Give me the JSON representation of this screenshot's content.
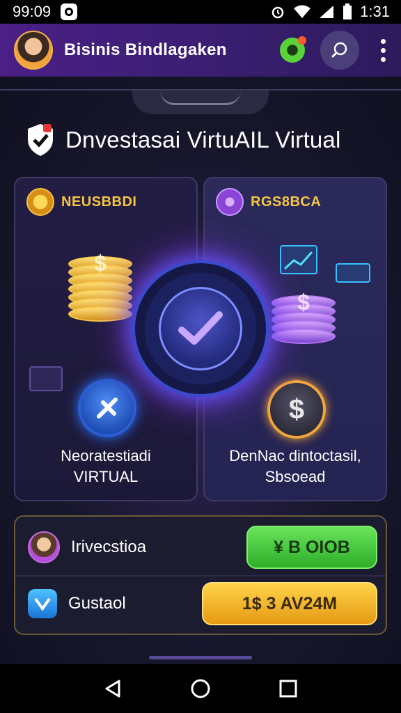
{
  "status_bar": {
    "time_left": "99:09",
    "time_right": "1:31"
  },
  "app_bar": {
    "title": "Bisinis Bindlagaken"
  },
  "headline": "Dnvestasai VirtuAIL Virtual",
  "panels": {
    "left": {
      "badge": "NEUSBBDI",
      "caption_line1": "Neoratestiadi",
      "caption_line2": "VIRTUAL"
    },
    "right": {
      "badge": "RGS8BCA",
      "caption_line1": "DenNac dintoctasil,",
      "caption_line2": "Sbsoead"
    }
  },
  "bottom_card": {
    "row1": {
      "label": "Irivecstioa",
      "button": "¥ B OIOB"
    },
    "row2": {
      "label": "Gustaol",
      "button": "1$ 3 AV24M"
    }
  },
  "colors": {
    "accent_purple": "#4a1f86",
    "green_button": "#2fae2a",
    "gold_button": "#e59a12"
  }
}
